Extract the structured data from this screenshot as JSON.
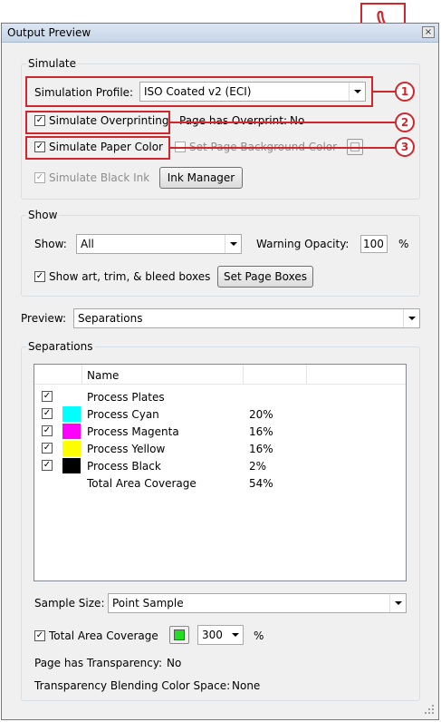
{
  "window": {
    "title": "Output Preview",
    "close_symbol": "×"
  },
  "logo": {
    "name": "adobe-acrobat-logo"
  },
  "simulate": {
    "group_label": "Simulate",
    "profile_label": "Simulation Profile:",
    "profile_value": "ISO Coated v2 (ECI)",
    "overprinting_label": "Simulate Overprinting",
    "overprinting_checked": true,
    "page_has_overprint_label": "Page has Overprint:",
    "page_has_overprint_value": "No",
    "paper_color_label": "Simulate Paper Color",
    "paper_color_checked": true,
    "page_bg_label": "Set Page Background Color",
    "page_bg_checked": false,
    "black_ink_label": "Simulate Black Ink",
    "black_ink_checked": true,
    "ink_manager_label": "Ink Manager"
  },
  "callouts": [
    "1",
    "2",
    "3"
  ],
  "show": {
    "group_label": "Show",
    "show_label": "Show:",
    "show_value": "All",
    "warning_opacity_label": "Warning Opacity:",
    "warning_opacity_value": "100",
    "percent": "%",
    "boxes_label": "Show art, trim, & bleed boxes",
    "boxes_checked": true,
    "set_page_boxes_label": "Set Page Boxes"
  },
  "preview": {
    "label": "Preview:",
    "value": "Separations"
  },
  "separations": {
    "group_label": "Separations",
    "col_name": "Name",
    "rows": [
      {
        "checked": true,
        "color": "",
        "name": "Process Plates",
        "value": ""
      },
      {
        "checked": true,
        "color": "#00ffff",
        "name": "Process Cyan",
        "value": "20%"
      },
      {
        "checked": true,
        "color": "#ff00ff",
        "name": "Process Magenta",
        "value": "16%"
      },
      {
        "checked": true,
        "color": "#ffff00",
        "name": "Process Yellow",
        "value": "16%"
      },
      {
        "checked": true,
        "color": "#000000",
        "name": "Process Black",
        "value": "2%"
      },
      {
        "checked": false,
        "color": "",
        "name": "Total Area Coverage",
        "value": "54%"
      }
    ]
  },
  "sample": {
    "label": "Sample Size:",
    "value": "Point Sample"
  },
  "tac": {
    "label": "Total Area Coverage",
    "checked": true,
    "swatch_color": "#22dd22",
    "value": "300",
    "percent": "%"
  },
  "transparency": {
    "label": "Page has Transparency:",
    "value": "No",
    "space_label": "Transparency Blending Color Space:",
    "space_value": "None"
  },
  "colors": {
    "accent_red": "#d0262c"
  }
}
